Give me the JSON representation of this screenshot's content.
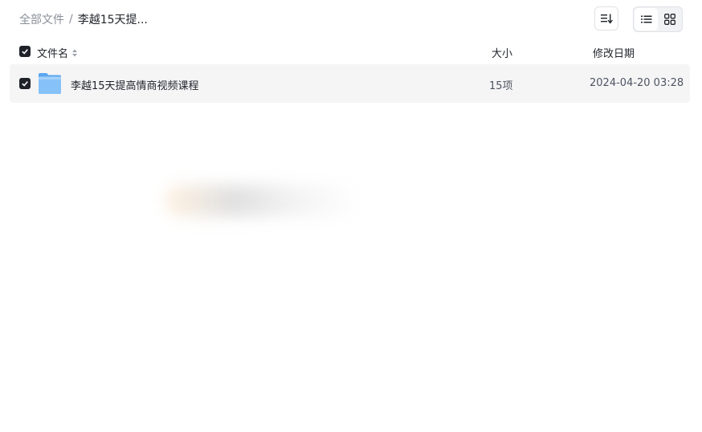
{
  "breadcrumb": {
    "root": "全部文件",
    "separator": "/",
    "current": "李越15天提..."
  },
  "toolbar": {
    "sort_icon": "sort-icon",
    "list_view_icon": "list-view-icon",
    "grid_view_icon": "grid-view-icon",
    "active_view": "list"
  },
  "table": {
    "headers": {
      "name": "文件名",
      "size": "大小",
      "modified": "修改日期"
    },
    "rows": [
      {
        "icon": "folder-icon",
        "name": "李越15天提高情商视频课程",
        "size": "15项",
        "modified": "2024-04-20 03:28",
        "checked": true
      }
    ]
  },
  "colors": {
    "checkbox": "#1f2329",
    "row_highlight": "#f5f5f6",
    "folder": "#78b8f5",
    "text_primary": "#1f2329",
    "text_secondary": "#8a8f99"
  }
}
